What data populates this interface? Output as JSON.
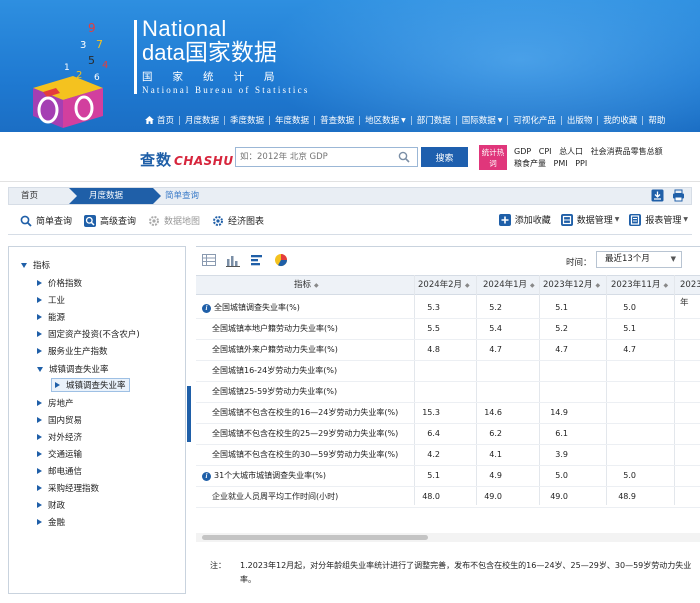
{
  "header": {
    "logo_en_1": "National",
    "logo_en_2_data": "data",
    "logo_en_2_cn": "国家数据",
    "logo_cn_bureau": "国家统计局",
    "logo_en_bureau": "National Bureau of Statistics"
  },
  "nav": {
    "home": "首页",
    "items": [
      "月度数据",
      "季度数据",
      "年度数据",
      "普查数据",
      "地区数据",
      "部门数据",
      "国际数据",
      "可视化产品",
      "出版物",
      "我的收藏",
      "帮助"
    ]
  },
  "search": {
    "brand_cn": "查数",
    "brand_en": "CHASHU",
    "placeholder": "如：2012年 北京 GDP",
    "button_label": "搜索",
    "hot_badge": "统计热词",
    "hot_links_line1": [
      "GDP",
      "CPI",
      "总人口",
      "社会消费品零售总额"
    ],
    "hot_links_line2": [
      "粮食产量",
      "PMI",
      "PPI"
    ]
  },
  "breadcrumb": {
    "home": "首页",
    "monthly": "月度数据",
    "current": "简单查询"
  },
  "toolbar": {
    "simple_query": "简单查询",
    "advanced_query": "高级查询",
    "data_map": "数据地图",
    "economic_chart": "经济图表",
    "add_favorite": "添加收藏",
    "data_manage": "数据管理",
    "report_manage": "报表管理"
  },
  "sidebar": {
    "root": "指标",
    "items": [
      "价格指数",
      "工业",
      "能源",
      "固定资产投资(不含农户)",
      "服务业生产指数",
      "城镇调查失业率",
      "城镇调查失业率",
      "房地产",
      "国内贸易",
      "对外经济",
      "交通运输",
      "邮电通信",
      "采购经理指数",
      "财政",
      "金融"
    ]
  },
  "table": {
    "time_label": "时间：",
    "time_value": "最近13个月",
    "header_indicator": "指标",
    "columns": [
      "2024年2月",
      "2024年1月",
      "2023年12月",
      "2023年11月",
      "2023年"
    ],
    "rows": [
      {
        "name": "全国城镇调查失业率(%)",
        "info": true,
        "values": [
          "5.3",
          "5.2",
          "5.1",
          "5.0",
          ""
        ]
      },
      {
        "name": "全国城镇本地户籍劳动力失业率(%)",
        "info": false,
        "values": [
          "5.5",
          "5.4",
          "5.2",
          "5.1",
          ""
        ]
      },
      {
        "name": "全国城镇外来户籍劳动力失业率(%)",
        "info": false,
        "values": [
          "4.8",
          "4.7",
          "4.7",
          "4.7",
          ""
        ]
      },
      {
        "name": "全国城镇16-24岁劳动力失业率(%)",
        "info": false,
        "values": [
          "",
          "",
          "",
          "",
          ""
        ]
      },
      {
        "name": "全国城镇25-59岁劳动力失业率(%)",
        "info": false,
        "values": [
          "",
          "",
          "",
          "",
          ""
        ]
      },
      {
        "name": "全国城镇不包含在校生的16—24岁劳动力失业率(%)",
        "info": false,
        "values": [
          "15.3",
          "14.6",
          "14.9",
          "",
          ""
        ]
      },
      {
        "name": "全国城镇不包含在校生的25—29岁劳动力失业率(%)",
        "info": false,
        "values": [
          "6.4",
          "6.2",
          "6.1",
          "",
          ""
        ]
      },
      {
        "name": "全国城镇不包含在校生的30—59岁劳动力失业率(%)",
        "info": false,
        "values": [
          "4.2",
          "4.1",
          "3.9",
          "",
          ""
        ]
      },
      {
        "name": "31个大城市城镇调查失业率(%)",
        "info": true,
        "values": [
          "5.1",
          "4.9",
          "5.0",
          "5.0",
          ""
        ]
      },
      {
        "name": "企业就业人员周平均工作时间(小时)",
        "info": false,
        "values": [
          "48.0",
          "49.0",
          "49.0",
          "48.9",
          ""
        ]
      }
    ],
    "note_label": "注：",
    "note_text": "1.2023年12月起，对分年龄组失业率统计进行了调整完善，发布不包含在校生的16—24岁、25—29岁、30—59岁劳动力失业率。"
  },
  "colors": {
    "header_blue": "#1f7ad2",
    "brand_blue": "#1f5fa8",
    "hot_pink": "#e0367b"
  }
}
